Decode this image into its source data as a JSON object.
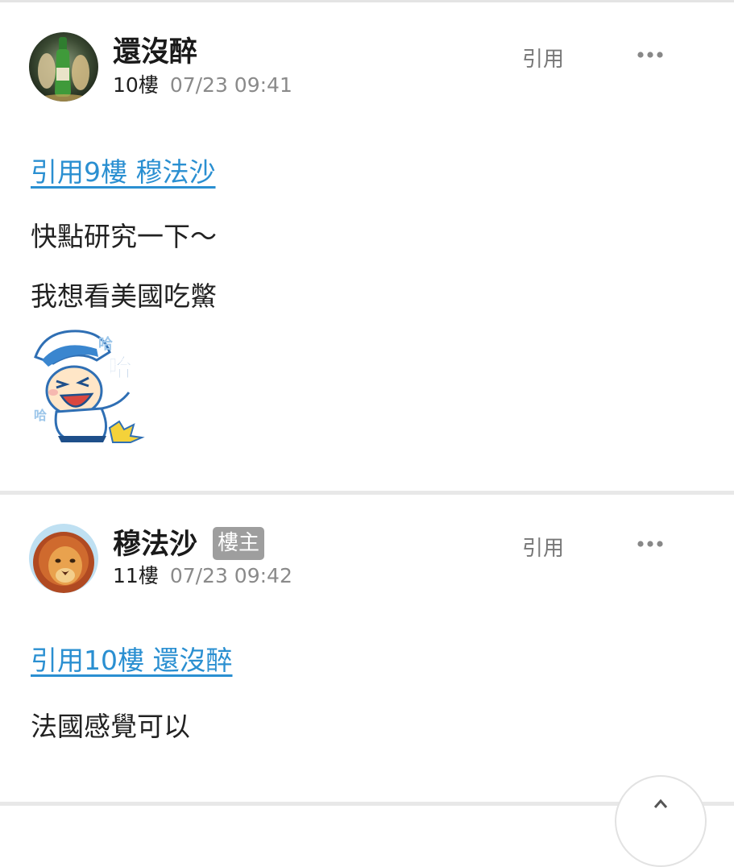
{
  "posts": [
    {
      "username": "還沒醉",
      "floor": "10樓",
      "timestamp": "07/23 09:41",
      "quote_action": "引用",
      "quote_link": "引用9樓 穆法沙",
      "body_lines": [
        "快點研究一下～",
        "我想看美國吃鱉"
      ],
      "avatar": "beer-bottle-avatar",
      "sticker": "laughing-cartoon-sticker",
      "sticker_text": "哈"
    },
    {
      "username": "穆法沙",
      "badge": "樓主",
      "floor": "11樓",
      "timestamp": "07/23 09:42",
      "quote_action": "引用",
      "quote_link": "引用10樓 還沒醉",
      "body_lines": [
        "法國感覺可以"
      ],
      "avatar": "lion-king-avatar"
    }
  ],
  "colors": {
    "link": "#2a8fd1",
    "badge_bg": "#9e9e9e",
    "muted_text": "#8a8a8a",
    "divider": "#e8e8e8"
  },
  "icons": {
    "more": "more-dots-icon",
    "scroll_top": "scroll-to-top-icon"
  }
}
